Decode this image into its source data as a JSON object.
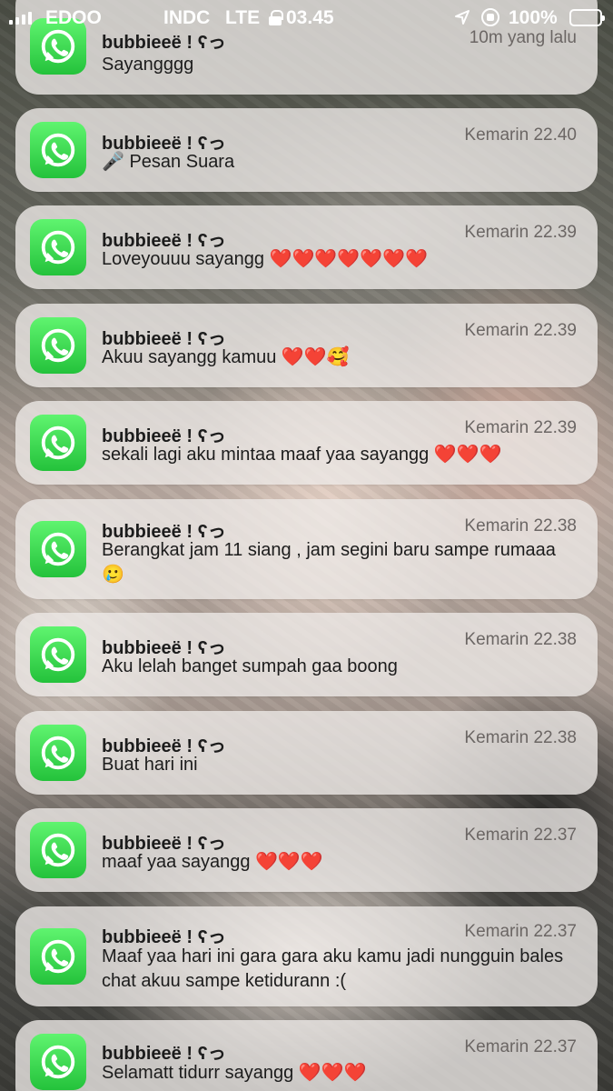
{
  "status_bar": {
    "carrier": "EDOO",
    "carrier2": "INDC",
    "network": "LTE",
    "time": "03.45",
    "battery": "100%"
  },
  "app": {
    "icon": "whatsapp-icon",
    "brand_color": "#25D366"
  },
  "notifications": [
    {
      "sender": "bubbieeë ! ʕっ",
      "time": "10m yang lalu",
      "message": "Sayangggg"
    },
    {
      "sender": "bubbieeë ! ʕっ",
      "time": "Kemarin 22.40",
      "message": "🎤 Pesan Suara"
    },
    {
      "sender": "bubbieeë ! ʕっ",
      "time": "Kemarin 22.39",
      "message": "Loveyouuu sayangg ❤️❤️❤️❤️❤️❤️❤️"
    },
    {
      "sender": "bubbieeë ! ʕっ",
      "time": "Kemarin 22.39",
      "message": "Akuu sayangg kamuu ❤️❤️🥰"
    },
    {
      "sender": "bubbieeë ! ʕっ",
      "time": "Kemarin 22.39",
      "message": "sekali lagi aku mintaa maaf yaa sayangg ❤️❤️❤️"
    },
    {
      "sender": "bubbieeë ! ʕっ",
      "time": "Kemarin 22.38",
      "message": "Berangkat jam 11 siang , jam segini baru sampe rumaaa 🥲"
    },
    {
      "sender": "bubbieeë ! ʕっ",
      "time": "Kemarin 22.38",
      "message": "Aku lelah banget sumpah gaa boong"
    },
    {
      "sender": "bubbieeë ! ʕっ",
      "time": "Kemarin 22.38",
      "message": "Buat hari ini"
    },
    {
      "sender": "bubbieeë ! ʕっ",
      "time": "Kemarin 22.37",
      "message": "maaf yaa sayangg ❤️❤️❤️"
    },
    {
      "sender": "bubbieeë ! ʕっ",
      "time": "Kemarin 22.37",
      "message": "Maaf yaa hari ini gara gara aku kamu jadi nungguin bales chat akuu sampe ketidurann :("
    },
    {
      "sender": "bubbieeë ! ʕっ",
      "time": "Kemarin 22.37",
      "message": "Selamatt tidurr sayangg ❤️❤️❤️"
    }
  ]
}
